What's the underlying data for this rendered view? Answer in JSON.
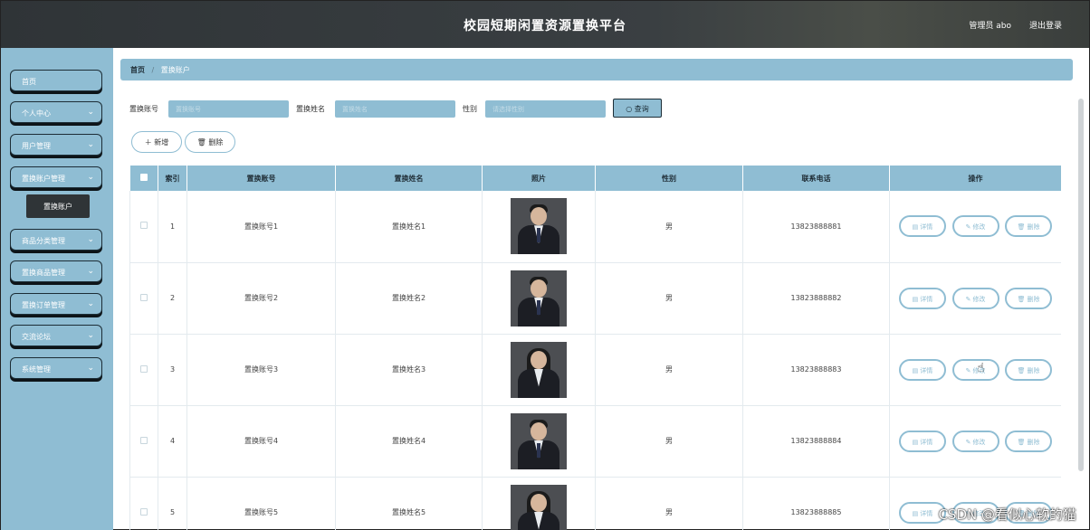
{
  "header": {
    "title": "校园短期闲置资源置换平台",
    "admin": "管理员 abo",
    "logout": "退出登录"
  },
  "sidebar": {
    "items": [
      {
        "label": "首页",
        "has_chevron": false
      },
      {
        "label": "个人中心",
        "has_chevron": true
      },
      {
        "label": "用户管理",
        "has_chevron": true
      },
      {
        "label": "置换账户管理",
        "has_chevron": true
      },
      {
        "label": "商品分类管理",
        "has_chevron": true
      },
      {
        "label": "置换商品管理",
        "has_chevron": true
      },
      {
        "label": "置换订单管理",
        "has_chevron": true
      },
      {
        "label": "交流论坛",
        "has_chevron": true
      },
      {
        "label": "系统管理",
        "has_chevron": true
      }
    ],
    "submenu_active": "置换账户"
  },
  "breadcrumb": {
    "home": "首页",
    "current": "置换账户"
  },
  "search": {
    "account_label": "置换账号",
    "account_placeholder": "置换账号",
    "name_label": "置换姓名",
    "name_placeholder": "置换姓名",
    "gender_label": "性别",
    "gender_placeholder": "请选择性别",
    "query_label": "查询"
  },
  "actions": {
    "add": "新增",
    "delete": "删除"
  },
  "table": {
    "headers": [
      "",
      "索引",
      "置换账号",
      "置换姓名",
      "照片",
      "性别",
      "联系电话",
      "操作"
    ],
    "rows": [
      {
        "index": "1",
        "account": "置换账号1",
        "name": "置换姓名1",
        "gender": "男",
        "phone": "13823888881",
        "photo": "man"
      },
      {
        "index": "2",
        "account": "置换账号2",
        "name": "置换姓名2",
        "gender": "男",
        "phone": "13823888882",
        "photo": "man"
      },
      {
        "index": "3",
        "account": "置换账号3",
        "name": "置换姓名3",
        "gender": "男",
        "phone": "13823888883",
        "photo": "woman"
      },
      {
        "index": "4",
        "account": "置换账号4",
        "name": "置换姓名4",
        "gender": "男",
        "phone": "13823888884",
        "photo": "man"
      },
      {
        "index": "5",
        "account": "置换账号5",
        "name": "置换姓名5",
        "gender": "男",
        "phone": "13823888885",
        "photo": "woman"
      }
    ],
    "row_actions": {
      "detail": "详情",
      "edit": "修改",
      "delete": "删除"
    }
  },
  "watermark": "CSDN @看似心软的猫",
  "colors": {
    "accent": "#8fbdd3",
    "header": "#2f3437",
    "dark": "#1c2d36"
  },
  "icons": {
    "chevron": "chevron-down-icon",
    "search": "search-icon",
    "add": "plus-icon",
    "trash": "trash-icon",
    "detail": "document-icon",
    "edit": "pencil-icon"
  }
}
